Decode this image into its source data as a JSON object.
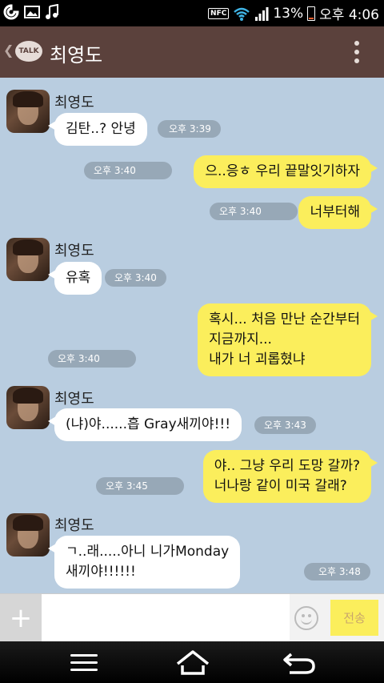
{
  "status_bar": {
    "battery": "13%",
    "time": "오후 4:06",
    "nfc": "NFC"
  },
  "header": {
    "logo_text": "TALK",
    "title": "최영도"
  },
  "messages": [
    {
      "sender": "최영도",
      "text": "김탄..? 안녕",
      "time": "오후 3:39"
    },
    {
      "text": "으..응ㅎ 우리 끝말잇기하자",
      "time": "오후 3:40"
    },
    {
      "text": "너부터해",
      "time": "오후 3:40"
    },
    {
      "sender": "최영도",
      "text": "유혹",
      "time": "오후 3:40"
    },
    {
      "text": "혹시... 처음 만난 순간부터\n지금까지...\n내가 너 괴롭혔냐",
      "time": "오후 3:40"
    },
    {
      "sender": "최영도",
      "text": "(냐)야......흡 Gray새끼야!!!",
      "time": "오후 3:43"
    },
    {
      "text": "야.. 그냥 우리 도망 갈까?\n너나랑 같이 미국 갈래?",
      "time": "오후 3:45"
    },
    {
      "sender": "최영도",
      "text": "ㄱ..래.....아니 니가Monday\n새끼야!!!!!!",
      "time": "오후 3:48"
    }
  ],
  "input": {
    "plus": "+",
    "send_label": "전송",
    "value": ""
  },
  "icons": {
    "back": "chevron-left-icon",
    "menu": "more-vertical-icon",
    "emoji": "smiley-icon",
    "nav_menu": "menu-icon",
    "nav_home": "home-icon",
    "nav_back": "back-icon"
  }
}
